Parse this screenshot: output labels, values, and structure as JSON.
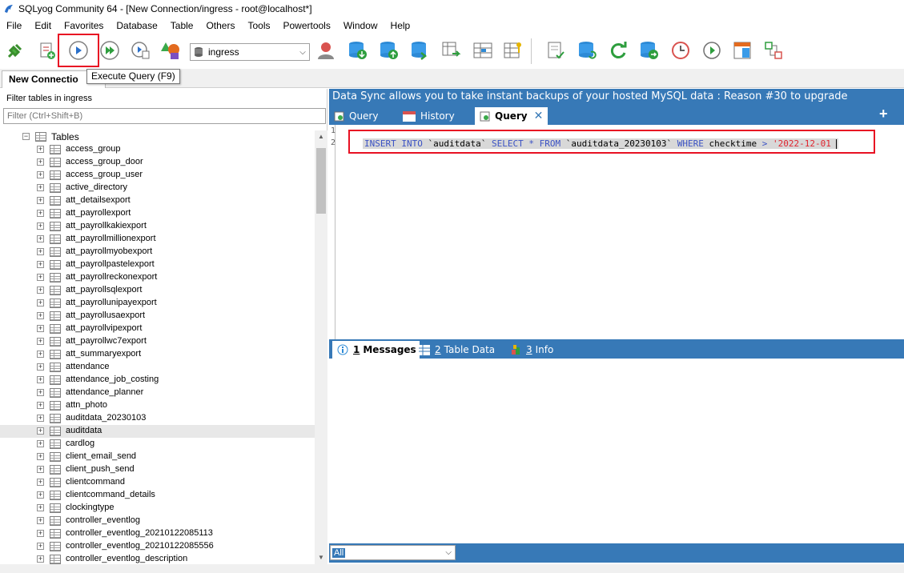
{
  "window": {
    "title": "SQLyog Community 64 - [New Connection/ingress - root@localhost*]"
  },
  "menu": [
    "File",
    "Edit",
    "Favorites",
    "Database",
    "Table",
    "Others",
    "Tools",
    "Powertools",
    "Window",
    "Help"
  ],
  "toolbar": {
    "database_selected": "ingress",
    "tooltip": "Execute Query (F9)"
  },
  "connection_tab": {
    "label": "New Connectio"
  },
  "left_panel": {
    "filter_label": "Filter tables in ingress",
    "filter_placeholder": "Filter (Ctrl+Shift+B)",
    "tables_node": "Tables",
    "tables": [
      "access_group",
      "access_group_door",
      "access_group_user",
      "active_directory",
      "att_detailsexport",
      "att_payrollexport",
      "att_payrollkakiexport",
      "att_payrollmillionexport",
      "att_payrollmyobexport",
      "att_payrollpastelexport",
      "att_payrollreckonexport",
      "att_payrollsqlexport",
      "att_payrollunipayexport",
      "att_payrollusaexport",
      "att_payrollvipexport",
      "att_payrollwc7export",
      "att_summaryexport",
      "attendance",
      "attendance_job_costing",
      "attendance_planner",
      "attn_photo",
      "auditdata_20230103",
      "auditdata",
      "cardlog",
      "client_email_send",
      "client_push_send",
      "clientcommand",
      "clientcommand_details",
      "clockingtype",
      "controller_eventlog",
      "controller_eventlog_20210122085113",
      "controller_eventlog_20210122085556",
      "controller_eventlog_description"
    ],
    "selected_table": "auditdata"
  },
  "promo": {
    "text": "Data Sync allows you to take instant backups of your hosted MySQL data : Reason #30 to upgrade"
  },
  "query_tabs": {
    "tab1": "Query",
    "tab2": "History",
    "tab2_icon_text": "18",
    "tab3": "Query"
  },
  "editor": {
    "line1": "1",
    "line2": "2",
    "sql": {
      "insert": "INSERT INTO",
      "target": "`auditdata`",
      "select": "SELECT",
      "star": "*",
      "from": "FROM",
      "source": "`auditdata_20230103`",
      "where": "WHERE",
      "column": "checktime",
      "op": ">",
      "value": "'2022-12-01"
    }
  },
  "result_tabs": {
    "messages_num": "1",
    "messages": "Messages",
    "tabledata_num": "2",
    "tabledata": "Table Data",
    "info_num": "3",
    "info": "Info"
  },
  "result_filter": {
    "value": "All"
  },
  "colors": {
    "accent_blue": "#3779b7",
    "highlight_red": "#e81123"
  }
}
